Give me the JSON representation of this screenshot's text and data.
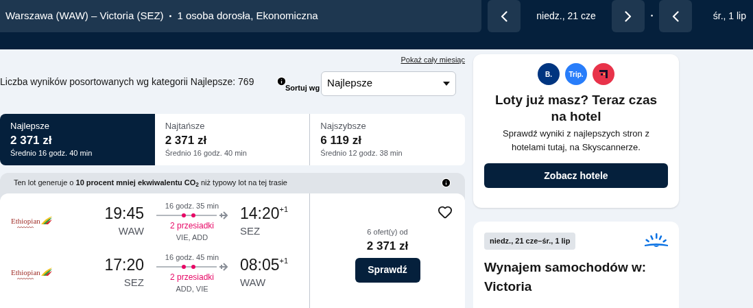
{
  "header": {
    "route": "Warszawa (WAW) – Victoria (SEZ)",
    "separator": "•",
    "passengers": "1 osoba dorosła, Ekonomiczna",
    "outbound_date": "niedz., 21 cze",
    "date_separator": "•",
    "return_date": "śr., 1 lip"
  },
  "month_link": "Pokaż cały miesiąc",
  "summary": "Liczba wyników posortowanych wg kategorii Najlepsze: 769",
  "sort": {
    "label": "Sortuj wg",
    "value": "Najlepsze"
  },
  "sort_tabs": [
    {
      "title": "Najlepsze",
      "price": "2 371 zł",
      "duration": "Średnio 16 godz. 40 min",
      "selected": true
    },
    {
      "title": "Najtańsze",
      "price": "2 371 zł",
      "duration": "Średnio 16 godz. 40 min",
      "selected": false
    },
    {
      "title": "Najszybsze",
      "price": "6 119 zł",
      "duration": "Średnio 12 godz. 38 min",
      "selected": false
    }
  ],
  "result": {
    "eco_note": "Ten lot generuje o **10 procent mniej ekwiwalentu CO$_{2}$** niż typowy lot na tej trasie",
    "legs": [
      {
        "airline": "Ethiopian",
        "depart_time": "19:45",
        "depart_airport": "WAW",
        "duration": "16 godz. 35 min",
        "stops": "2 przesiadki",
        "via": "VIE, ADD",
        "arrive_time": "14:20",
        "day_offset": "+1",
        "arrive_airport": "SEZ"
      },
      {
        "airline": "Ethiopian",
        "depart_time": "17:20",
        "depart_airport": "SEZ",
        "duration": "16 godz. 45 min",
        "stops": "2 przesiadki",
        "via": "ADD, VIE",
        "arrive_time": "08:05",
        "day_offset": "+1",
        "arrive_airport": "WAW"
      }
    ],
    "saved": false,
    "offers": "6 ofert(y) od",
    "price": "2 371 zł",
    "button": "Sprawdź"
  },
  "hotel_card": {
    "logos": [
      {
        "text": "B.",
        "color": "#003580"
      },
      {
        "text": "Trip.",
        "color": "#287dfa"
      },
      {
        "color": "#e8334a"
      }
    ],
    "title": "Loty już masz? Teraz czas na hotel",
    "text": "Sprawdź wyniki z najlepszych stron z hotelami tutaj, na Skyscannerze.",
    "button": "Zobacz hotele"
  },
  "car_card": {
    "dates": "niedz., 21 cze–śr., 1 lip",
    "title": "Wynajem samochodów w: Victoria"
  }
}
